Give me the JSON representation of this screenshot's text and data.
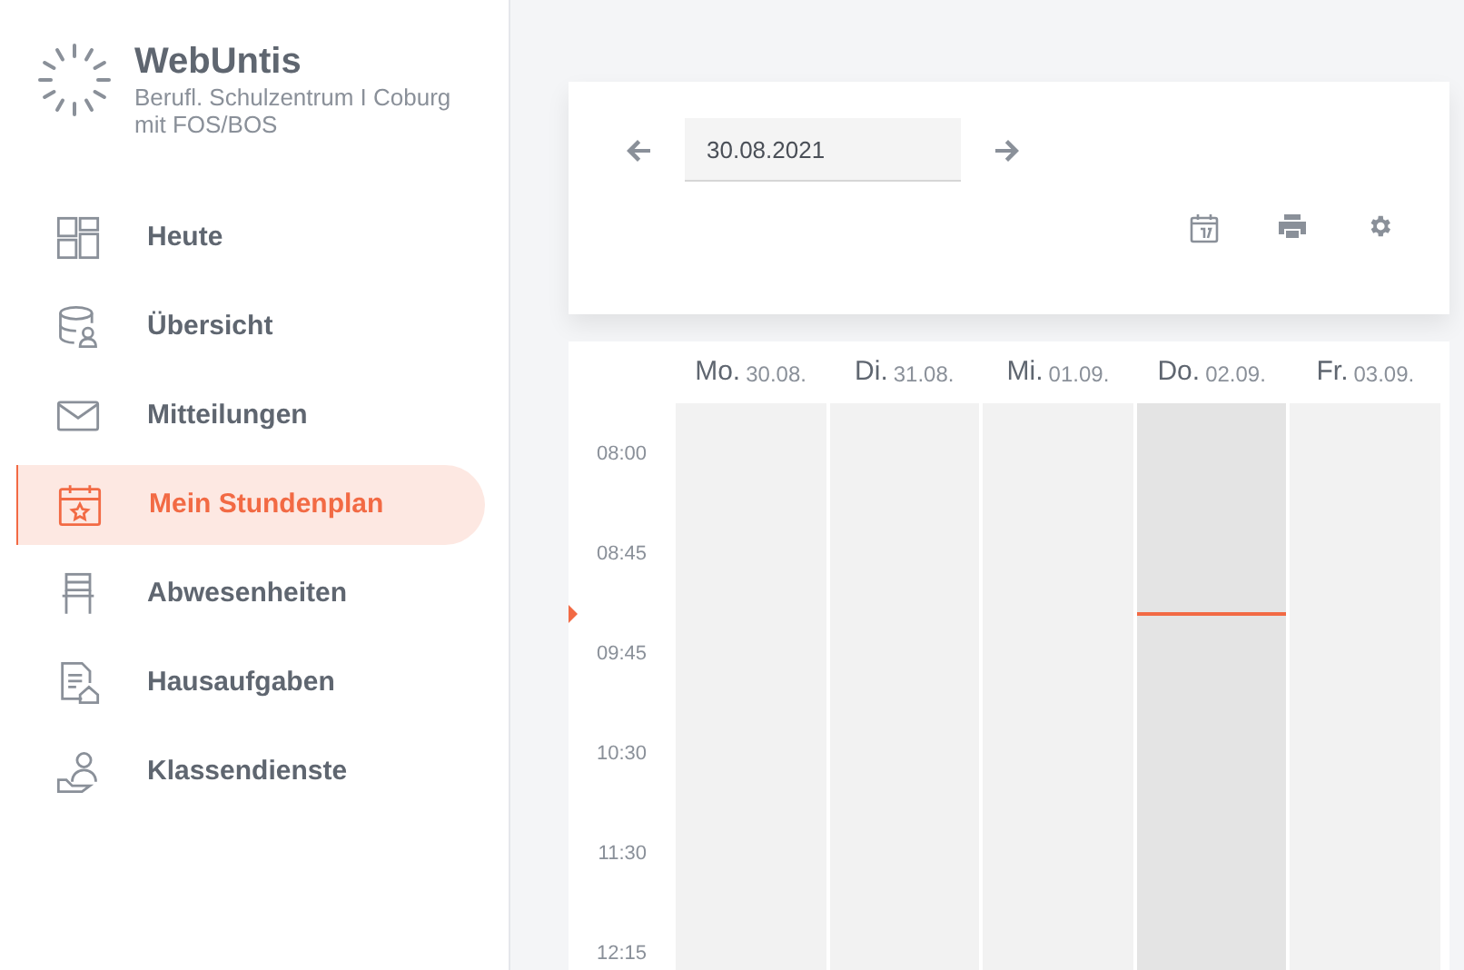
{
  "app": {
    "name": "WebUntis",
    "school": "Berufl. Schulzentrum I Coburg mit FOS/BOS"
  },
  "sidebar": {
    "items": [
      {
        "kind": "today",
        "label": "Heute",
        "selected": false
      },
      {
        "kind": "overview",
        "label": "Übersicht",
        "selected": false
      },
      {
        "kind": "messages",
        "label": "Mitteilungen",
        "selected": false
      },
      {
        "kind": "timetable",
        "label": "Mein Stundenplan",
        "selected": true
      },
      {
        "kind": "absences",
        "label": "Abwesenheiten",
        "selected": false
      },
      {
        "kind": "homework",
        "label": "Hausaufgaben",
        "selected": false
      },
      {
        "kind": "duties",
        "label": "Klassendienste",
        "selected": false
      }
    ]
  },
  "toolbar": {
    "date": "30.08.2021"
  },
  "timetable": {
    "days": [
      {
        "day": "Mo.",
        "date": "30.08.",
        "selected": false
      },
      {
        "day": "Di.",
        "date": "31.08.",
        "selected": false
      },
      {
        "day": "Mi.",
        "date": "01.09.",
        "selected": false
      },
      {
        "day": "Do.",
        "date": "02.09.",
        "selected": true
      },
      {
        "day": "Fr.",
        "date": "03.09.",
        "selected": false
      }
    ],
    "times": [
      "08:00",
      "08:45",
      "09:45",
      "10:30",
      "11:30",
      "12:15"
    ]
  }
}
